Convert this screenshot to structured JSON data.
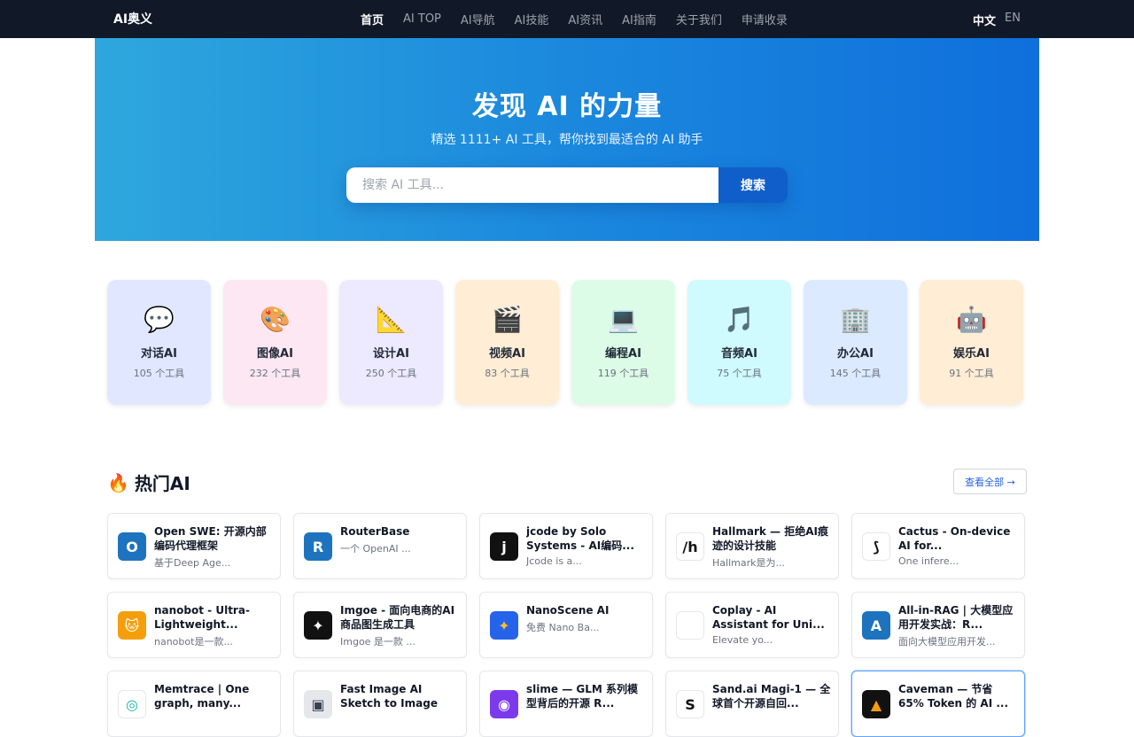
{
  "nav": {
    "brand": "AI奥义",
    "links": [
      "首页",
      "AI TOP",
      "AI导航",
      "AI技能",
      "AI资讯",
      "AI指南",
      "关于我们",
      "申请收录"
    ],
    "lang_zh": "中文",
    "lang_en": "EN"
  },
  "hero": {
    "title": "发现 AI 的力量",
    "subtitle": "精选 1111+ AI 工具，帮你找到最适合的 AI 助手",
    "search_placeholder": "搜索 AI 工具...",
    "search_button": "搜索"
  },
  "categories": [
    {
      "icon": "speech-bubble-icon",
      "glyph": "💬",
      "name": "对话AI",
      "count": "105 个工具",
      "bg": "#e0e7ff"
    },
    {
      "icon": "palette-icon",
      "glyph": "🎨",
      "name": "图像AI",
      "count": "232 个工具",
      "bg": "#fce7f3"
    },
    {
      "icon": "triangle-ruler-icon",
      "glyph": "📐",
      "name": "设计AI",
      "count": "250 个工具",
      "bg": "#ede9fe"
    },
    {
      "icon": "clapper-board-icon",
      "glyph": "🎬",
      "name": "视频AI",
      "count": "83 个工具",
      "bg": "#ffedd5"
    },
    {
      "icon": "laptop-icon",
      "glyph": "💻",
      "name": "编程AI",
      "count": "119 个工具",
      "bg": "#dcfce7"
    },
    {
      "icon": "music-note-icon",
      "glyph": "🎵",
      "name": "音频AI",
      "count": "75 个工具",
      "bg": "#cffafe"
    },
    {
      "icon": "office-building-icon",
      "glyph": "🏢",
      "name": "办公AI",
      "count": "145 个工具",
      "bg": "#dbeafe"
    },
    {
      "icon": "robot-icon",
      "glyph": "🤖",
      "name": "娱乐AI",
      "count": "91 个工具",
      "bg": "#ffedd5"
    }
  ],
  "hot": {
    "title": "热门AI",
    "fire_glyph": "🔥",
    "view_all": "查看全部 →"
  },
  "tools": [
    {
      "name": "Open SWE: 开源内部编码代理框架",
      "desc": "基于Deep Age...",
      "logo": "O",
      "logo_bg": "#1e73be",
      "logo_fg": "#ffffff"
    },
    {
      "name": "RouterBase",
      "desc": "一个 OpenAI ...",
      "logo": "R",
      "logo_bg": "#1e73be",
      "logo_fg": "#ffffff"
    },
    {
      "name": "jcode by Solo Systems - AI编码...",
      "desc": "Jcode is a...",
      "logo": "j",
      "logo_bg": "#111111",
      "logo_fg": "#ffffff"
    },
    {
      "name": "Hallmark — 拒绝AI痕迹的设计技能",
      "desc": "Hallmark是为...",
      "logo": "/h",
      "logo_bg": "#ffffff",
      "logo_fg": "#111111"
    },
    {
      "name": "Cactus - On-device AI for...",
      "desc": "One infere...",
      "logo": "⟆",
      "logo_bg": "#ffffff",
      "logo_fg": "#111111"
    },
    {
      "name": "nanobot - Ultra-Lightweight...",
      "desc": "nanobot是一款...",
      "logo": "🐱",
      "logo_bg": "#f59e0b",
      "logo_fg": "#ffffff"
    },
    {
      "name": "Imgoe - 面向电商的AI 商品图生成工具",
      "desc": "Imgoe 是一款 ...",
      "logo": "✦",
      "logo_bg": "#111111",
      "logo_fg": "#ffffff"
    },
    {
      "name": "NanoScene AI",
      "desc": "免费 Nano Ba...",
      "logo": "✦",
      "logo_bg": "#2563eb",
      "logo_fg": "#fbbf24"
    },
    {
      "name": "Coplay - AI Assistant for Uni...",
      "desc": "Elevate yo...",
      "logo": "",
      "logo_bg": "#ffffff",
      "logo_fg": "#111111"
    },
    {
      "name": "All-in-RAG | 大模型应用开发实战：R...",
      "desc": "面向大模型应用开发...",
      "logo": "A",
      "logo_bg": "#1e73be",
      "logo_fg": "#ffffff"
    },
    {
      "name": "Memtrace | One graph, many...",
      "desc": "",
      "logo": "◎",
      "logo_bg": "#ffffff",
      "logo_fg": "#14b8a6"
    },
    {
      "name": "Fast Image AI Sketch to Image",
      "desc": "",
      "logo": "▣",
      "logo_bg": "#e5e7eb",
      "logo_fg": "#374151"
    },
    {
      "name": "slime — GLM 系列模型背后的开源 R...",
      "desc": "",
      "logo": "◉",
      "logo_bg": "#7c3aed",
      "logo_fg": "#ffffff"
    },
    {
      "name": "Sand.ai Magi-1 — 全球首个开源自回...",
      "desc": "",
      "logo": "S",
      "logo_bg": "#ffffff",
      "logo_fg": "#111111"
    },
    {
      "name": "Caveman — 节省 65% Token 的 AI ...",
      "desc": "",
      "logo": "▲",
      "logo_bg": "#111111",
      "logo_fg": "#f59e0b"
    }
  ]
}
